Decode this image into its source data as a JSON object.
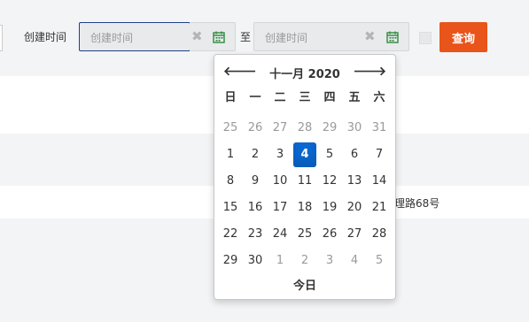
{
  "filter": {
    "created_label": "创建时间",
    "start_placeholder": "创建时间",
    "end_placeholder": "创建时间",
    "to_label": "至",
    "query_label": "查询"
  },
  "table": {
    "row2_text": "理路68号"
  },
  "datepicker": {
    "prev_icon": "arrow-left-icon",
    "next_icon": "arrow-right-icon",
    "month_title": "十一月 2020",
    "weekdays": [
      "日",
      "一",
      "二",
      "三",
      "四",
      "五",
      "六"
    ],
    "days": [
      [
        "25",
        "26",
        "27",
        "28",
        "29",
        "30",
        "31"
      ],
      [
        "1",
        "2",
        "3",
        "4",
        "5",
        "6",
        "7"
      ],
      [
        "8",
        "9",
        "10",
        "11",
        "12",
        "13",
        "14"
      ],
      [
        "15",
        "16",
        "17",
        "18",
        "19",
        "20",
        "21"
      ],
      [
        "22",
        "23",
        "24",
        "25",
        "26",
        "27",
        "28"
      ],
      [
        "29",
        "30",
        "1",
        "2",
        "3",
        "4",
        "5"
      ]
    ],
    "selected_day": "4",
    "today_label": "今日"
  },
  "colors": {
    "accent": "#e8541a",
    "selected": "#0b67d0"
  }
}
